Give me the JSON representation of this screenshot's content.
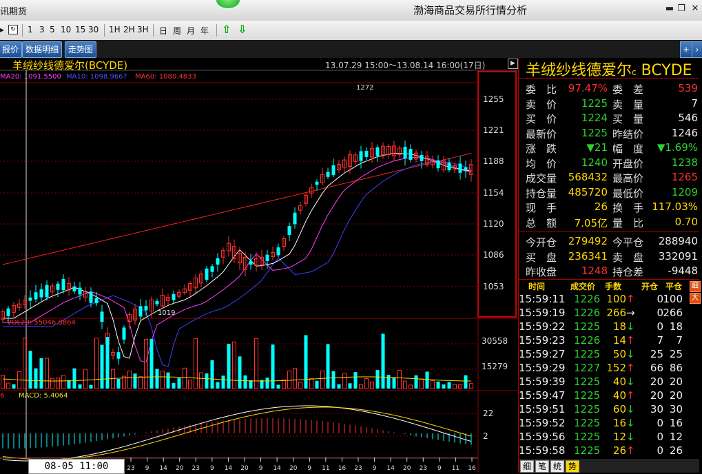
{
  "window": {
    "app_partial": "讯期货",
    "title": "渤海商品交易所行情分析",
    "min": "▬",
    "restore": "❐",
    "close": "✕"
  },
  "toolbar": {
    "periods": [
      "1",
      "3",
      "5",
      "10",
      "15",
      "30",
      "1H",
      "2H",
      "3H",
      "日",
      "周",
      "月",
      "年"
    ],
    "up_arrow": "⇧",
    "down_arrow": "⇩"
  },
  "tabs": [
    "报价",
    "数据明细",
    "走势图"
  ],
  "plus": "+",
  "chart": {
    "title": "羊绒纱线德爱尔(BCYDE)",
    "range": "13.07.29 15:00～13.08.14 16:00(17日)",
    "toggle": "▶",
    "legend": {
      "ma20": "MA20: 1091.5500",
      "ma10": "MA10: 1098.9667",
      "ma60": "MA60: 1080.4833"
    },
    "price_labels": [
      "1255",
      "1221",
      "1188",
      "1154",
      "1120",
      "1086",
      "1053"
    ],
    "high_label": "1272",
    "low_label": "1019",
    "vol_legend": "VOL20: 55046.8864",
    "vol_labels": [
      "30558",
      "15279"
    ],
    "macd_prefix": "6",
    "macd_legend": "MACD: 5.4064",
    "macd_labels": [
      "22",
      "2"
    ],
    "x_labels": [
      "23",
      "9",
      "14",
      "20",
      "23",
      "9",
      "14",
      "20",
      "9",
      "14",
      "20",
      "9",
      "11",
      "16",
      "23",
      "9",
      "14",
      "20",
      "23",
      "9",
      "11",
      "16"
    ],
    "cursor_time": "08-05 11:00"
  },
  "colors": {
    "up": "#ff3030",
    "down": "#00ffff",
    "grid": "#8b0000",
    "ma10": "#ffffff",
    "ma20": "#ff40ff",
    "ma60": "#4040ff",
    "ma_long": "#ff2020"
  },
  "panel": {
    "title": "羊绒纱线德爱尔",
    "title_sub": "c",
    "title_code": "BCYDE",
    "quotes": [
      {
        "l1": "委　比",
        "v1": "97.47%",
        "c1": "red",
        "l2": "委　差",
        "v2": "539",
        "c2": "red"
      },
      {
        "l1": "卖　价",
        "v1": "1225",
        "c1": "green",
        "l2": "卖　量",
        "v2": "7",
        "c2": "white"
      },
      {
        "l1": "买　价",
        "v1": "1224",
        "c1": "green",
        "l2": "买　量",
        "v2": "546",
        "c2": "white"
      },
      {
        "l1": "最新价",
        "v1": "1225",
        "c1": "green",
        "l2": "昨结价",
        "v2": "1246",
        "c2": "white"
      },
      {
        "l1": "涨　跌",
        "v1": "▼21",
        "c1": "green",
        "l2": "幅　度",
        "v2": "▼1.69%",
        "c2": "green"
      },
      {
        "l1": "均　价",
        "v1": "1240",
        "c1": "green",
        "l2": "开盘价",
        "v2": "1238",
        "c2": "green"
      },
      {
        "l1": "成交量",
        "v1": "568432",
        "c1": "yellow",
        "l2": "最高价",
        "v2": "1265",
        "c2": "red"
      },
      {
        "l1": "持仓量",
        "v1": "485720",
        "c1": "yellow",
        "l2": "最低价",
        "v2": "1209",
        "c2": "green"
      },
      {
        "l1": "现　手",
        "v1": "26",
        "c1": "yellow",
        "l2": "换　手",
        "v2": "117.03%",
        "c2": "yellow"
      },
      {
        "l1": "总　额",
        "v1": "7.05亿",
        "c1": "yellow",
        "l2": "量　比",
        "v2": "0.70",
        "c2": "yellow"
      }
    ],
    "positions": [
      {
        "l1": "今开仓",
        "v1": "279492",
        "c1": "yellow",
        "l2": "今平仓",
        "v2": "288940",
        "c2": "white"
      },
      {
        "l1": "买　盘",
        "v1": "236341",
        "c1": "yellow",
        "l2": "卖　盘",
        "v2": "332091",
        "c2": "white"
      },
      {
        "l1": "昨收盘",
        "v1": "1248",
        "c1": "red",
        "l2": "持仓差",
        "v2": "-9448",
        "c2": "white"
      }
    ],
    "tick_headers": [
      "时间",
      "成交价",
      "手数",
      "开仓",
      "平仓"
    ],
    "side_tags": [
      "细",
      "大"
    ],
    "ticks": [
      {
        "t": "15:59:11",
        "p": "1226",
        "v": "100",
        "d": "↑",
        "o": "0",
        "c": "100"
      },
      {
        "t": "15:59:19",
        "p": "1226",
        "v": "266",
        "d": "→",
        "o": "0",
        "c": "266"
      },
      {
        "t": "15:59:22",
        "p": "1225",
        "v": "18",
        "d": "↓",
        "o": "0",
        "c": "18"
      },
      {
        "t": "15:59:23",
        "p": "1226",
        "v": "14",
        "d": "↑",
        "o": "7",
        "c": "7"
      },
      {
        "t": "15:59:27",
        "p": "1225",
        "v": "50",
        "d": "↓",
        "o": "25",
        "c": "25"
      },
      {
        "t": "15:59:29",
        "p": "1227",
        "v": "152",
        "d": "↑",
        "o": "66",
        "c": "86"
      },
      {
        "t": "15:59:39",
        "p": "1225",
        "v": "40",
        "d": "↓",
        "o": "20",
        "c": "20"
      },
      {
        "t": "15:59:47",
        "p": "1225",
        "v": "40",
        "d": "↑",
        "o": "20",
        "c": "20"
      },
      {
        "t": "15:59:51",
        "p": "1225",
        "v": "60",
        "d": "↓",
        "o": "30",
        "c": "30"
      },
      {
        "t": "15:59:52",
        "p": "1225",
        "v": "16",
        "d": "↓",
        "o": "0",
        "c": "16"
      },
      {
        "t": "15:59:56",
        "p": "1225",
        "v": "12",
        "d": "↓",
        "o": "0",
        "c": "12"
      },
      {
        "t": "15:59:58",
        "p": "1225",
        "v": "26",
        "d": "↑",
        "o": "0",
        "c": "26"
      }
    ],
    "bottom_tabs": [
      "细",
      "笔",
      "统",
      "势"
    ]
  }
}
